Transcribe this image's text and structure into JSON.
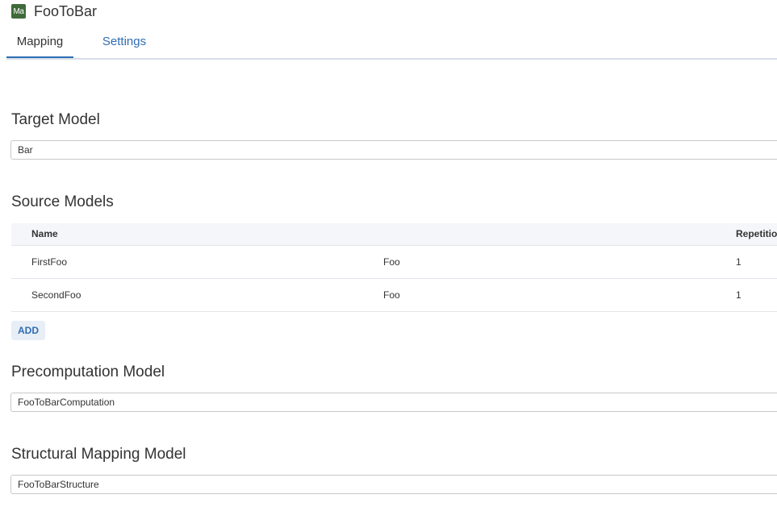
{
  "header": {
    "badge": "Ma",
    "title": "FooToBar"
  },
  "tabs": [
    {
      "label": "Mapping",
      "active": true
    },
    {
      "label": "Settings",
      "active": false
    }
  ],
  "target_model": {
    "heading": "Target Model",
    "value": "Bar"
  },
  "source_models": {
    "heading": "Source Models",
    "columns": [
      "Name",
      "",
      "Repetitio"
    ],
    "rows": [
      {
        "name": "FirstFoo",
        "model": "Foo",
        "repetition": "1"
      },
      {
        "name": "SecondFoo",
        "model": "Foo",
        "repetition": "1"
      }
    ],
    "add_label": "ADD"
  },
  "precomputation_model": {
    "heading": "Precomputation Model",
    "value": "FooToBarComputation"
  },
  "structural_mapping_model": {
    "heading": "Structural Mapping Model",
    "value": "FooToBarStructure"
  },
  "colors": {
    "accent": "#2e6db4",
    "badge": "#3f6b3a",
    "header_bg": "#f4f6f9"
  }
}
